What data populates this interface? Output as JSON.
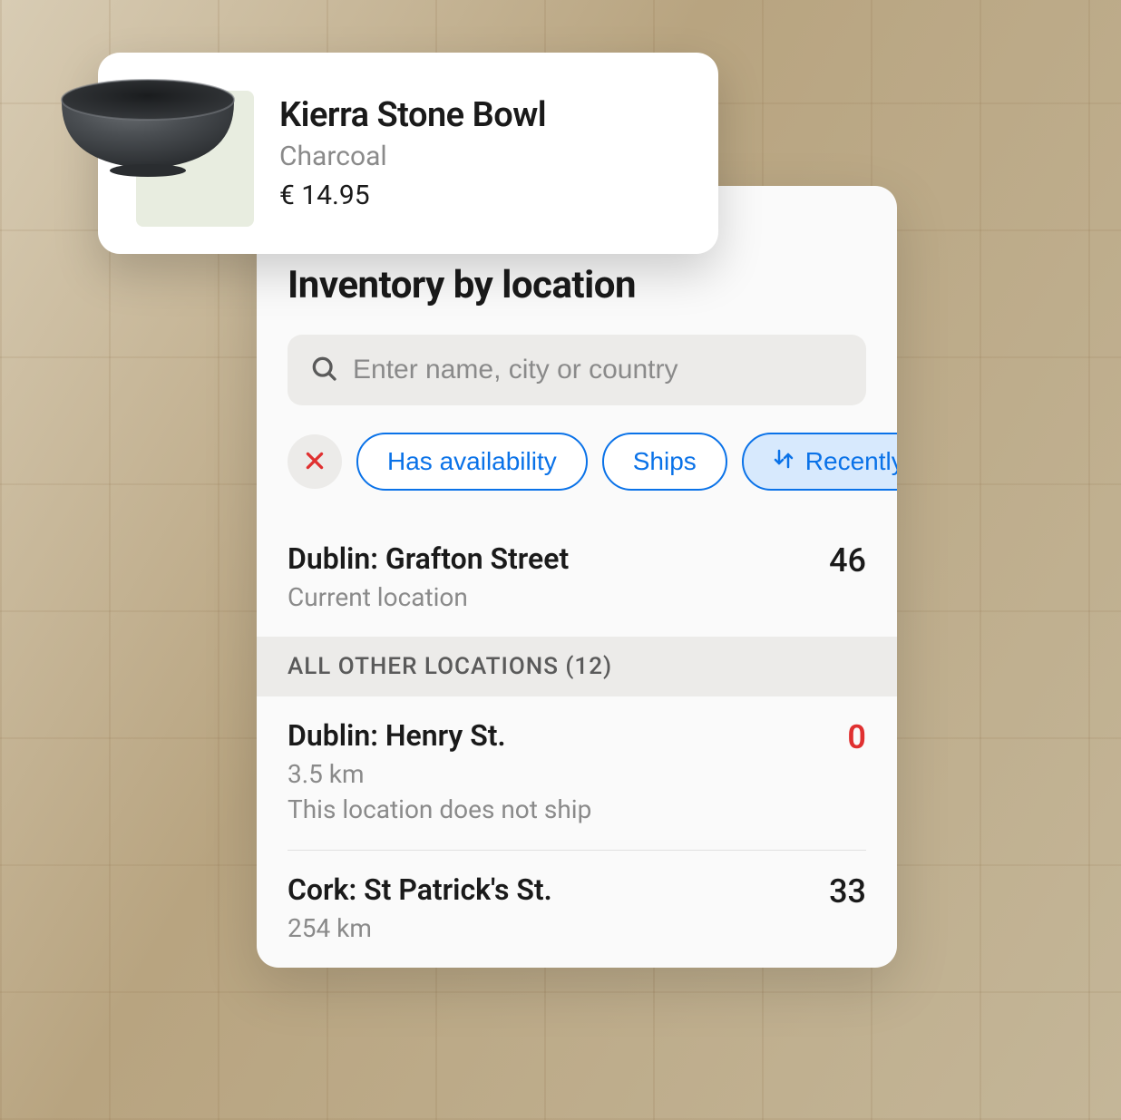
{
  "product": {
    "name": "Kierra Stone Bowl",
    "variant": "Charcoal",
    "price": "€ 14.95"
  },
  "panel": {
    "title": "Inventory by location",
    "search_placeholder": "Enter name, city or country"
  },
  "filters": {
    "has_availability": "Has availability",
    "ships": "Ships",
    "sort": "Recently used"
  },
  "current_location": {
    "name": "Dublin: Grafton Street",
    "label": "Current location",
    "qty": "46"
  },
  "other_locations": {
    "header": "ALL OTHER LOCATIONS (12)",
    "count": 12,
    "items": [
      {
        "name": "Dublin: Henry St.",
        "distance": "3.5 km",
        "note": "This location does not ship",
        "qty": "0",
        "zero": true
      },
      {
        "name": "Cork: St Patrick's St.",
        "distance": "254 km",
        "note": "",
        "qty": "33",
        "zero": false
      }
    ]
  }
}
